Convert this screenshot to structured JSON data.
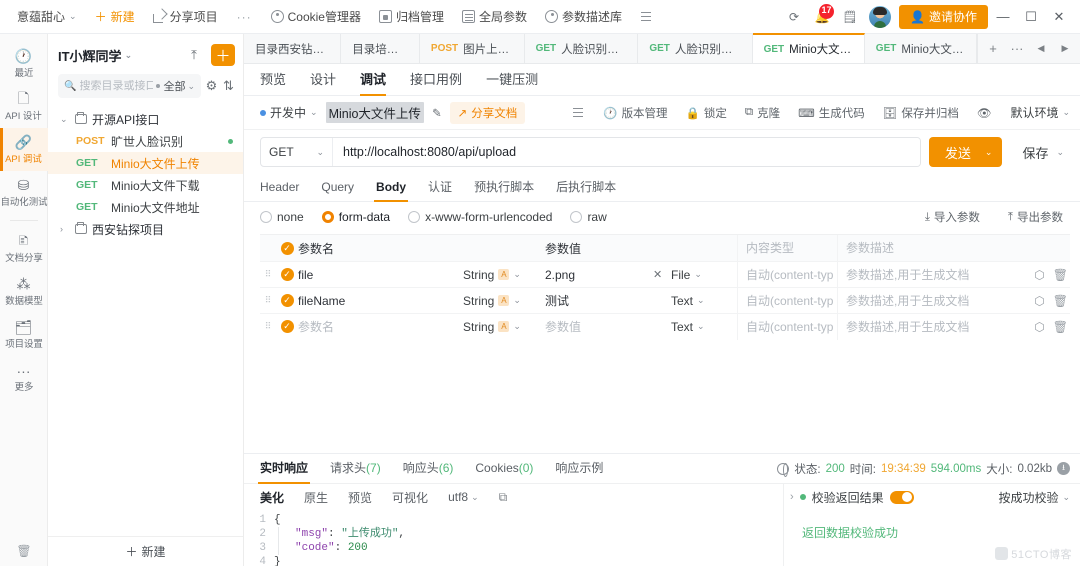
{
  "topbar": {
    "workspace": "意蕴甜心",
    "new_label": "新建",
    "share_project": "分享项目",
    "more_dots": "···",
    "cookie_manager": "Cookie管理器",
    "archive_manager": "归档管理",
    "global_params": "全局参数",
    "param_desc_lib": "参数描述库",
    "notification_count": "17",
    "invite_label": "邀请协作",
    "minimize": "—",
    "maximize": "☐",
    "close": "✕"
  },
  "rail": {
    "items": [
      {
        "label": "最近",
        "icon": "clock-icon"
      },
      {
        "label": "API 设计",
        "icon": "document-icon"
      },
      {
        "label": "API 调试",
        "icon": "link-icon"
      },
      {
        "label": "自动化测试",
        "icon": "flow-icon"
      },
      {
        "label": "文档分享",
        "icon": "share-doc-icon"
      },
      {
        "label": "数据模型",
        "icon": "model-icon"
      },
      {
        "label": "项目设置",
        "icon": "settings-icon"
      },
      {
        "label": "更多",
        "icon": "ellipsis-icon"
      }
    ],
    "active_index": 2
  },
  "tree": {
    "title": "IT小辉同学",
    "search_placeholder": "搜索目录或接口",
    "filter_label": "全部",
    "folders": [
      {
        "name": "开源API接口",
        "expanded": true
      },
      {
        "name": "西安钻探项目",
        "expanded": false
      }
    ],
    "apis": [
      {
        "method": "POST",
        "name": "旷世人脸识别",
        "active": false,
        "dot": true
      },
      {
        "method": "GET",
        "name": "Minio大文件上传",
        "active": true,
        "dot": false
      },
      {
        "method": "GET",
        "name": "Minio大文件下载",
        "active": false,
        "dot": false
      },
      {
        "method": "GET",
        "name": "Minio大文件地址",
        "active": false,
        "dot": false
      }
    ],
    "new_label": "新建"
  },
  "tabs": [
    {
      "method": "",
      "title": "目录西安钻探项目",
      "active": false
    },
    {
      "method": "",
      "title": "目录培训模块",
      "active": false
    },
    {
      "method": "POST",
      "title": "图片上传请求",
      "active": false
    },
    {
      "method": "GET",
      "title": "人脸识别接口（L",
      "active": false
    },
    {
      "method": "GET",
      "title": "人脸识别接口（F",
      "active": false
    },
    {
      "method": "GET",
      "title": "Minio大文件上传",
      "active": true
    },
    {
      "method": "GET",
      "title": "Minio大文件下载",
      "active": false
    }
  ],
  "tab_controls": {
    "add": "+",
    "more": "···",
    "prev": "◀",
    "next": "▶"
  },
  "subtabs": [
    {
      "label": "预览",
      "active": false
    },
    {
      "label": "设计",
      "active": false
    },
    {
      "label": "调试",
      "active": true
    },
    {
      "label": "接口用例",
      "active": false
    },
    {
      "label": "一键压测",
      "active": false
    }
  ],
  "namerow": {
    "status": "开发中",
    "api_name": "Minio大文件上传",
    "share_doc": "分享文档",
    "tools": [
      {
        "label": "版本管理",
        "icon": "history-icon"
      },
      {
        "label": "锁定",
        "icon": "lock-icon"
      },
      {
        "label": "克隆",
        "icon": "clone-icon"
      },
      {
        "label": "生成代码",
        "icon": "code-icon"
      },
      {
        "label": "保存并归档",
        "icon": "archive-icon"
      }
    ],
    "env_label": "默认环境"
  },
  "urlrow": {
    "method": "GET",
    "url": "http://localhost:8080/api/upload",
    "send_label": "发送",
    "save_label": "保存"
  },
  "paramtabs": [
    {
      "label": "Header",
      "active": false
    },
    {
      "label": "Query",
      "active": false
    },
    {
      "label": "Body",
      "active": true
    },
    {
      "label": "认证",
      "active": false
    },
    {
      "label": "预执行脚本",
      "active": false
    },
    {
      "label": "后执行脚本",
      "active": false
    }
  ],
  "bodytypes": [
    {
      "label": "none",
      "selected": false
    },
    {
      "label": "form-data",
      "selected": true
    },
    {
      "label": "x-www-form-urlencoded",
      "selected": false
    },
    {
      "label": "raw",
      "selected": false
    }
  ],
  "param_actions": {
    "import": "导入参数",
    "export": "导出参数"
  },
  "table": {
    "headers": {
      "name": "参数名",
      "value": "参数值",
      "content_type": "内容类型",
      "description": "参数描述"
    },
    "rows": [
      {
        "name": "file",
        "name_is_placeholder": false,
        "type": "String",
        "value": "2.png",
        "value_is_placeholder": false,
        "has_clear": true,
        "value_type": "File",
        "content_type": "自动(content-typ",
        "description": "参数描述,用于生成文档"
      },
      {
        "name": "fileName",
        "name_is_placeholder": false,
        "type": "String",
        "value": "测试",
        "value_is_placeholder": false,
        "has_clear": false,
        "value_type": "Text",
        "content_type": "自动(content-typ",
        "description": "参数描述,用于生成文档"
      },
      {
        "name": "参数名",
        "name_is_placeholder": true,
        "type": "String",
        "value": "参数值",
        "value_is_placeholder": true,
        "has_clear": false,
        "value_type": "Text",
        "content_type": "自动(content-typ",
        "description": "参数描述,用于生成文档"
      }
    ]
  },
  "response": {
    "tabs": [
      {
        "label": "实时响应",
        "count": "",
        "active": true
      },
      {
        "label": "请求头",
        "count": "(7)",
        "active": false
      },
      {
        "label": "响应头",
        "count": "(6)",
        "active": false
      },
      {
        "label": "Cookies",
        "count": "(0)",
        "active": false
      },
      {
        "label": "响应示例",
        "count": "",
        "active": false
      }
    ],
    "status_label": "状态:",
    "status_code": "200",
    "time_label": "时间:",
    "time_value": "19:34:39",
    "duration": "594.00ms",
    "size_label": "大小:",
    "size_value": "0.02kb",
    "formats": [
      {
        "label": "美化",
        "active": true
      },
      {
        "label": "原生",
        "active": false
      },
      {
        "label": "预览",
        "active": false
      },
      {
        "label": "可视化",
        "active": false
      }
    ],
    "encoding": "utf8",
    "code_lines": [
      "1",
      "2",
      "3",
      "4"
    ],
    "json": {
      "open": "{",
      "msg_key": "\"msg\"",
      "msg_value": "\"上传成功\"",
      "code_key": "\"code\"",
      "code_value": "200",
      "close": "}"
    },
    "validate_label": "校验返回结果",
    "validate_mode": "按成功校验",
    "validate_result": "返回数据校验成功"
  },
  "watermark": "51CTO博客"
}
